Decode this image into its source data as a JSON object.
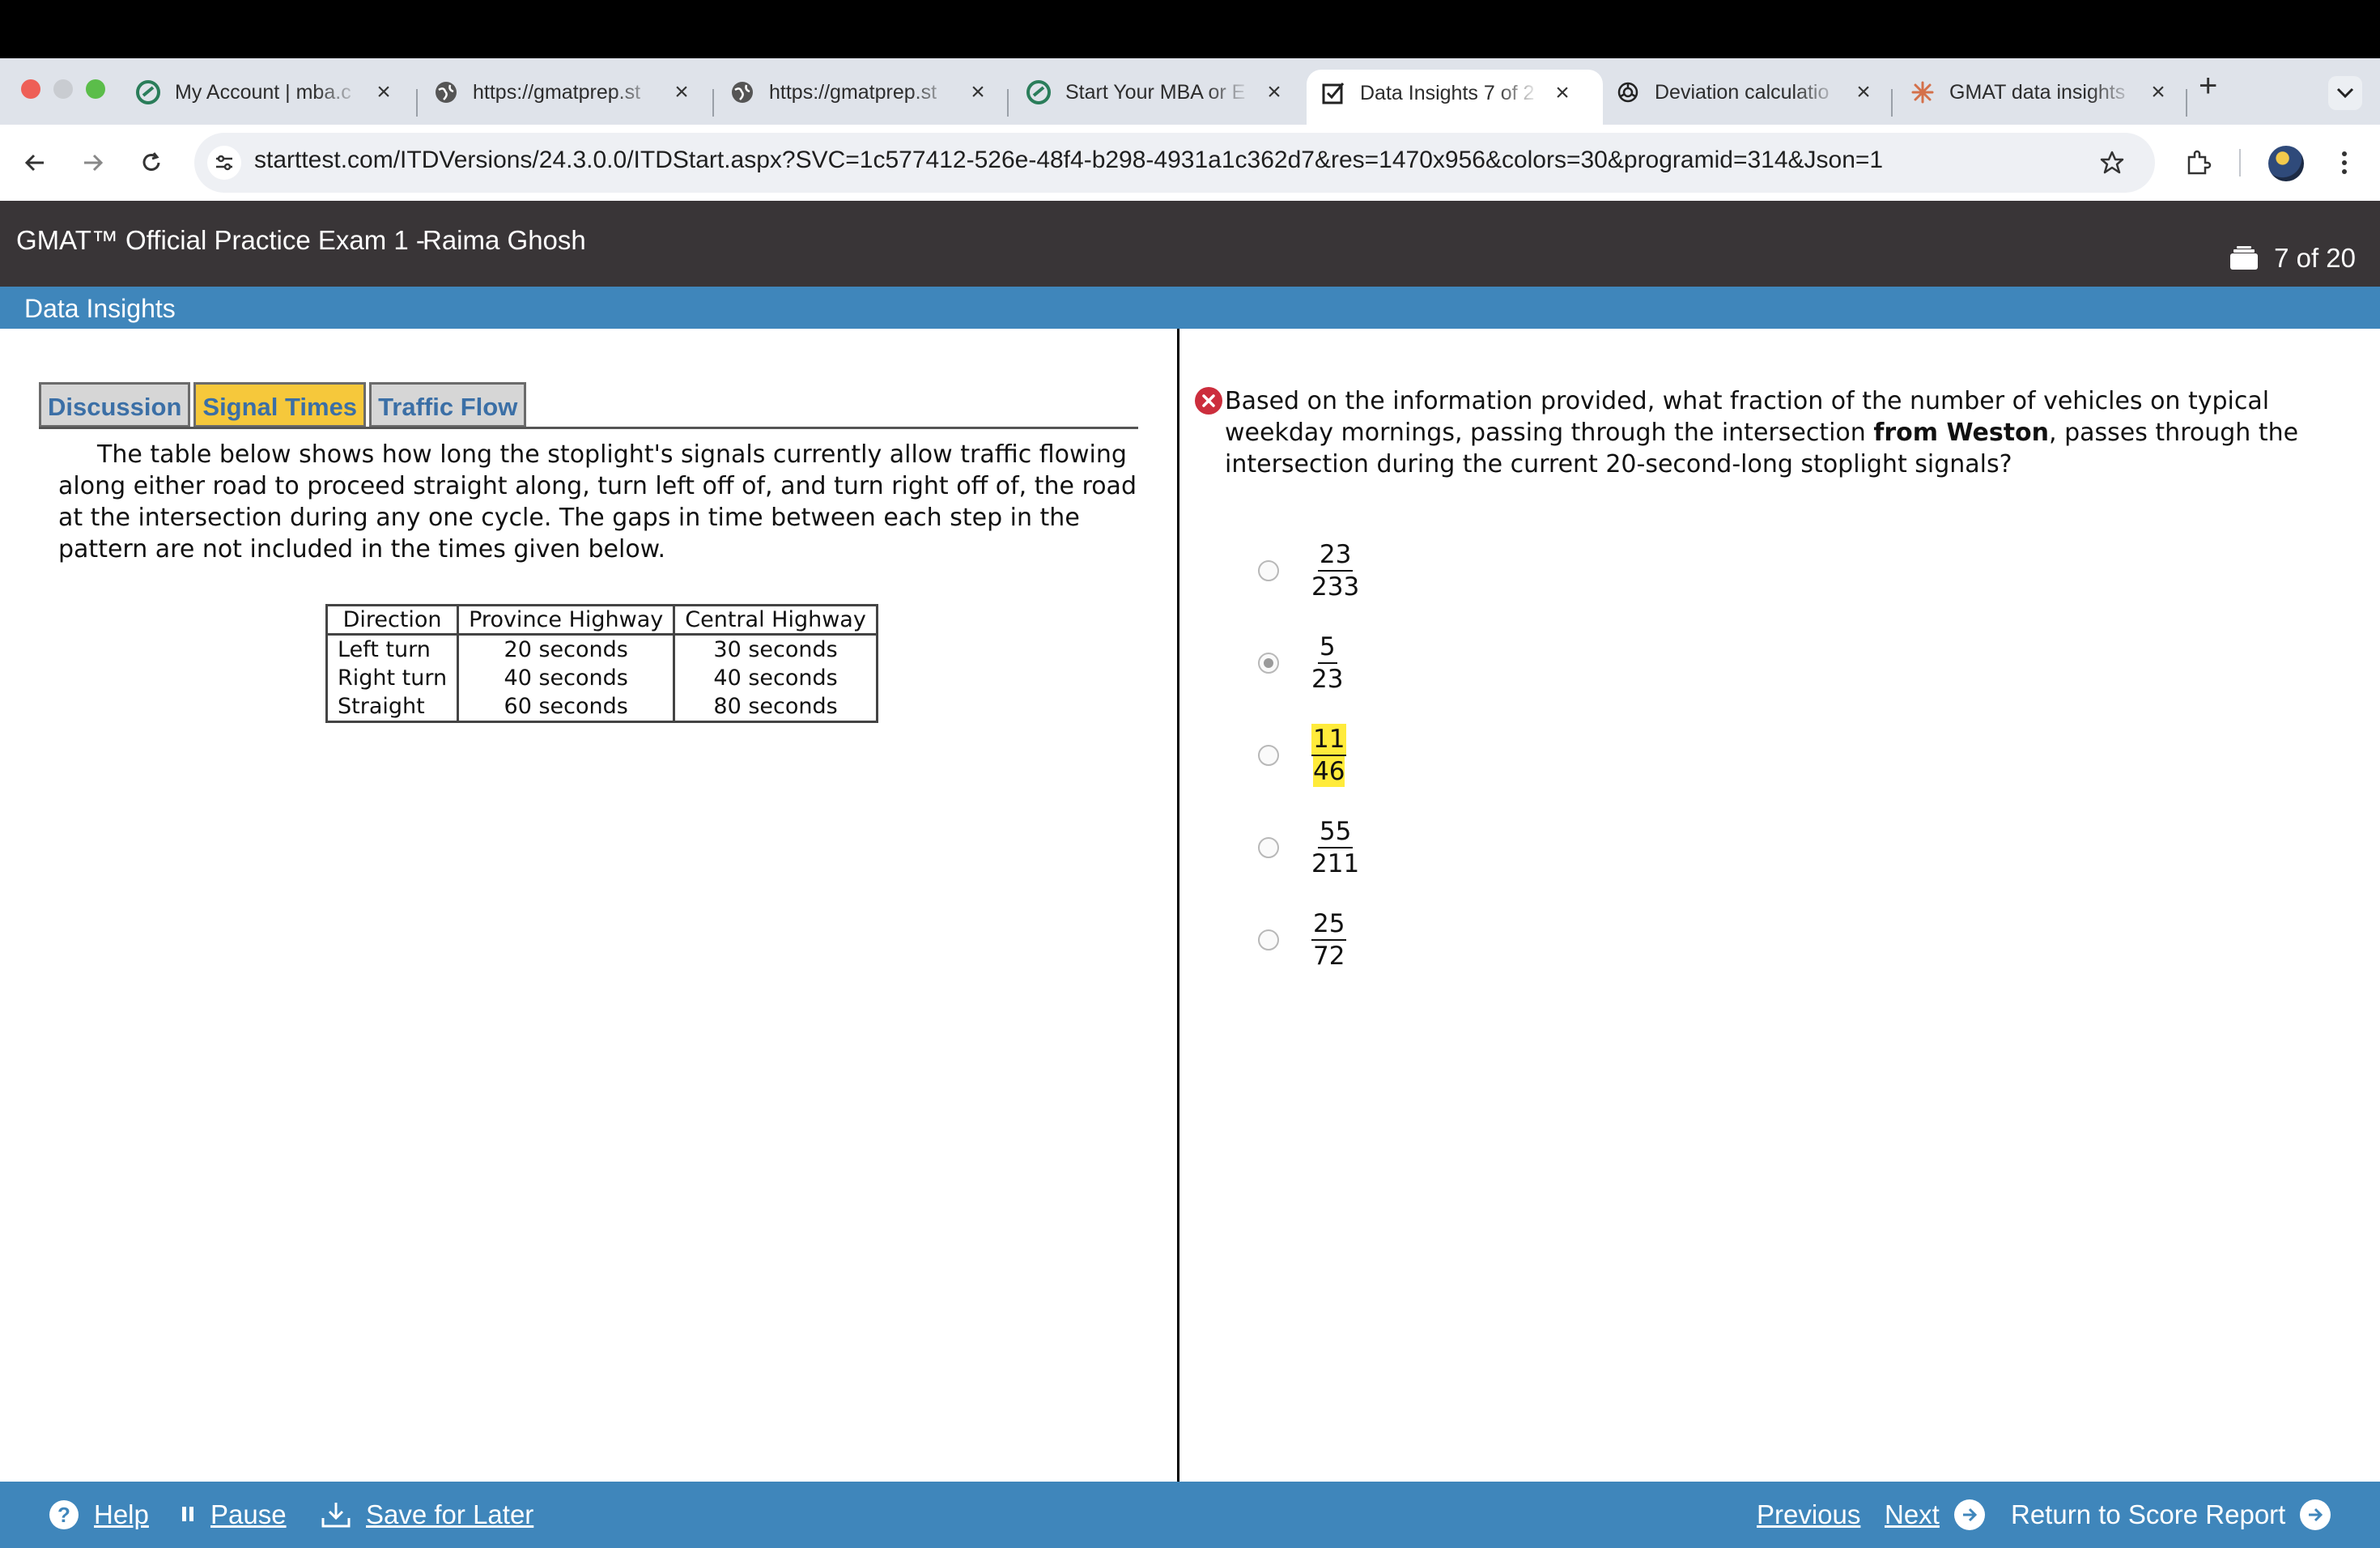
{
  "browser": {
    "tabs": [
      {
        "title": "My Account | mba.c",
        "icon": "mba-logo-icon"
      },
      {
        "title": "https://gmatprep.st",
        "icon": "globe-icon"
      },
      {
        "title": "https://gmatprep.st",
        "icon": "globe-icon"
      },
      {
        "title": "Start Your MBA or E",
        "icon": "mba-logo-icon"
      },
      {
        "title": "Data Insights 7 of 2",
        "icon": "checkbox-pen-icon",
        "active": true
      },
      {
        "title": "Deviation calculatio",
        "icon": "openai-icon"
      },
      {
        "title": "GMAT data insights",
        "icon": "claude-icon"
      }
    ],
    "new_tab": "+",
    "url": "starttest.com/ITDVersions/24.3.0.0/ITDStart.aspx?SVC=1c577412-526e-48f4-b298-4931a1c362d7&res=1470x956&colors=30&programid=314&Json=1"
  },
  "exam": {
    "title": "GMAT™ Official Practice Exam 1 -",
    "candidate": "Raima Ghosh",
    "progress": "7 of 20",
    "section": "Data Insights"
  },
  "left": {
    "tabs": [
      "Discussion",
      "Signal Times",
      "Traffic Flow"
    ],
    "active_tab": "Signal Times",
    "paragraph": "The table below shows how long the stoplight's signals currently allow traffic flowing along either road to proceed straight along, turn left off of, and turn right off of, the road at the intersection during any one cycle. The gaps in time between each step in the pattern are not included in the times given below.",
    "table": {
      "headers": [
        "Direction",
        "Province Highway",
        "Central Highway"
      ],
      "rows": [
        [
          "Left turn",
          "20 seconds",
          "30 seconds"
        ],
        [
          "Right turn",
          "40 seconds",
          "40 seconds"
        ],
        [
          "Straight",
          "60 seconds",
          "80 seconds"
        ]
      ]
    }
  },
  "question": {
    "status": "incorrect",
    "text_before": "Based on the information provided, what fraction of the number of vehicles on typical weekday mornings, passing through the intersection ",
    "text_bold": "from Weston",
    "text_after": ", passes through the intersection during the current 20-second-long stoplight signals?",
    "options": [
      {
        "num": "23",
        "den": "233",
        "selected": false,
        "highlighted": false
      },
      {
        "num": "5",
        "den": "23",
        "selected": true,
        "highlighted": false
      },
      {
        "num": "11",
        "den": "46",
        "selected": false,
        "highlighted": true
      },
      {
        "num": "55",
        "den": "211",
        "selected": false,
        "highlighted": false
      },
      {
        "num": "25",
        "den": "72",
        "selected": false,
        "highlighted": false
      }
    ]
  },
  "footer": {
    "help": "Help",
    "pause": "Pause",
    "save": "Save for Later",
    "previous": "Previous",
    "next": "Next",
    "return": "Return to Score Report"
  },
  "colors": {
    "header_bg": "#393537",
    "accent_blue": "#3f86bb",
    "active_tab": "#f6c83b",
    "highlight": "#ffeb3b",
    "wrong": "#cc2e3d"
  }
}
